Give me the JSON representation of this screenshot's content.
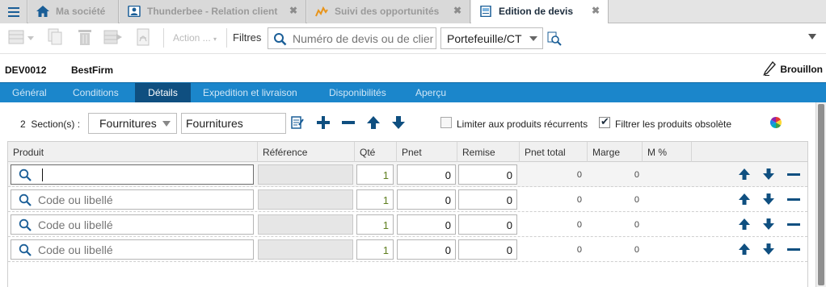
{
  "app": {
    "tabs": [
      {
        "label": "Ma société",
        "icon": "home-icon",
        "closable": false
      },
      {
        "label": "Thunderbee - Relation client",
        "icon": "contact-card-icon",
        "closable": true
      },
      {
        "label": "Suivi des opportunités",
        "icon": "trend-line-icon",
        "closable": true
      },
      {
        "label": "Edition de devis",
        "icon": "document-icon",
        "closable": true,
        "active": true
      }
    ],
    "close_glyph": "✖"
  },
  "toolbar": {
    "action_label": "Action ...",
    "filters_label": "Filtres",
    "search_placeholder": "Numéro de devis ou de client",
    "portfolio_value": "Portefeuille/CT"
  },
  "document": {
    "id": "DEV0012",
    "client": "BestFirm",
    "status": "Brouillon"
  },
  "section_tabs": [
    {
      "label": "Général"
    },
    {
      "label": "Conditions"
    },
    {
      "label": "Détails",
      "active": true
    },
    {
      "label": "Expedition et livraison"
    },
    {
      "label": "Disponibilités"
    },
    {
      "label": "Aperçu"
    }
  ],
  "sections": {
    "count": "2",
    "count_label": "Section(s) :",
    "selected": "Fournitures",
    "name_value": "Fournitures"
  },
  "options": {
    "recurring_label": "Limiter aux produits récurrents",
    "recurring_checked": false,
    "obsolete_label": "Filtrer les produits obsolète",
    "obsolete_checked": true,
    "check_glyph": "✔"
  },
  "grid": {
    "columns": [
      "Produit",
      "Référence",
      "Qté",
      "Pnet",
      "Remise",
      "Pnet total",
      "Marge",
      "M %"
    ],
    "product_placeholder": "Code ou libellé",
    "rows": [
      {
        "product": "",
        "qty": "1",
        "pnet": "0",
        "discount": "0",
        "total": "0",
        "margin": "0"
      },
      {
        "product": "",
        "qty": "1",
        "pnet": "0",
        "discount": "0",
        "total": "0",
        "margin": "0"
      },
      {
        "product": "",
        "qty": "1",
        "pnet": "0",
        "discount": "0",
        "total": "0",
        "margin": "0"
      },
      {
        "product": "",
        "qty": "1",
        "pnet": "0",
        "discount": "0",
        "total": "0",
        "margin": "0"
      }
    ]
  },
  "colors": {
    "accent": "#1b86cb",
    "accent_dark": "#0f4f80"
  }
}
